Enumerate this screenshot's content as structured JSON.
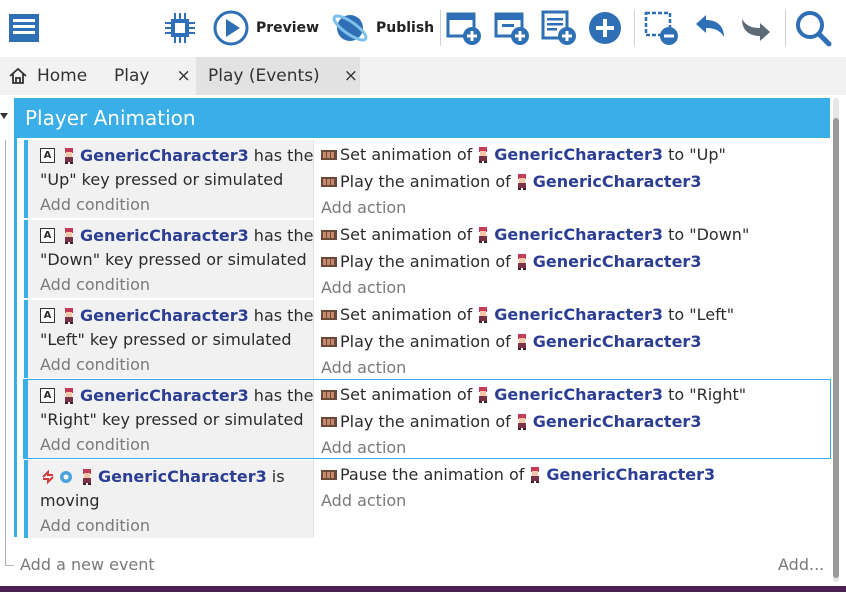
{
  "toolbar": {
    "preview_label": "Preview",
    "publish_label": "Publish",
    "icons": [
      "project-manager-icon",
      "debugger-icon",
      "preview-icon",
      "publish-icon",
      "add-event-icon",
      "add-subevent-icon",
      "add-comment-icon",
      "add-more-icon",
      "delete-icon",
      "undo-icon",
      "redo-icon",
      "search-icon"
    ]
  },
  "tabs": [
    {
      "label": "Home",
      "icon": "home-icon"
    },
    {
      "label": "Play",
      "close": "×"
    },
    {
      "label": "Play (Events)",
      "close": "×"
    }
  ],
  "group": {
    "title": "Player Animation"
  },
  "events": [
    {
      "cond_obj": "GenericCharacter3",
      "cond_rest1": " has the",
      "cond_line2": "\"Up\" key pressed or simulated",
      "add_condition": "Add condition",
      "act1_prefix": "Set animation of",
      "act1_obj": "GenericCharacter3",
      "act1_suffix": " to \"Up\"",
      "act2_prefix": "Play the animation of",
      "act2_obj": "GenericCharacter3",
      "add_action": "Add action"
    },
    {
      "cond_obj": "GenericCharacter3",
      "cond_rest1": " has the",
      "cond_line2": "\"Down\" key pressed or simulated",
      "add_condition": "Add condition",
      "act1_prefix": "Set animation of",
      "act1_obj": "GenericCharacter3",
      "act1_suffix": " to \"Down\"",
      "act2_prefix": "Play the animation of",
      "act2_obj": "GenericCharacter3",
      "add_action": "Add action"
    },
    {
      "cond_obj": "GenericCharacter3",
      "cond_rest1": " has the",
      "cond_line2": "\"Left\" key pressed or simulated",
      "add_condition": "Add condition",
      "act1_prefix": "Set animation of",
      "act1_obj": "GenericCharacter3",
      "act1_suffix": " to \"Left\"",
      "act2_prefix": "Play the animation of",
      "act2_obj": "GenericCharacter3",
      "add_action": "Add action"
    },
    {
      "cond_obj": "GenericCharacter3",
      "cond_rest1": " has the",
      "cond_line2": "\"Right\" key pressed or simulated",
      "add_condition": "Add condition",
      "act1_prefix": "Set animation of",
      "act1_obj": "GenericCharacter3",
      "act1_suffix": " to \"Right\"",
      "act2_prefix": "Play the animation of",
      "act2_obj": "GenericCharacter3",
      "add_action": "Add action"
    }
  ],
  "last_event": {
    "cond_obj": "GenericCharacter3",
    "cond_rest1": " is",
    "cond_line2": "moving",
    "add_condition": "Add condition",
    "act1_prefix": "Pause the animation of",
    "act1_obj": "GenericCharacter3",
    "add_action": "Add action"
  },
  "footer": {
    "add_new_event": "Add a new event",
    "add_more": "Add..."
  },
  "colors": {
    "accent": "#3aaee6",
    "object_name": "#2c3e94",
    "condition_bg": "#f1f1f1"
  }
}
